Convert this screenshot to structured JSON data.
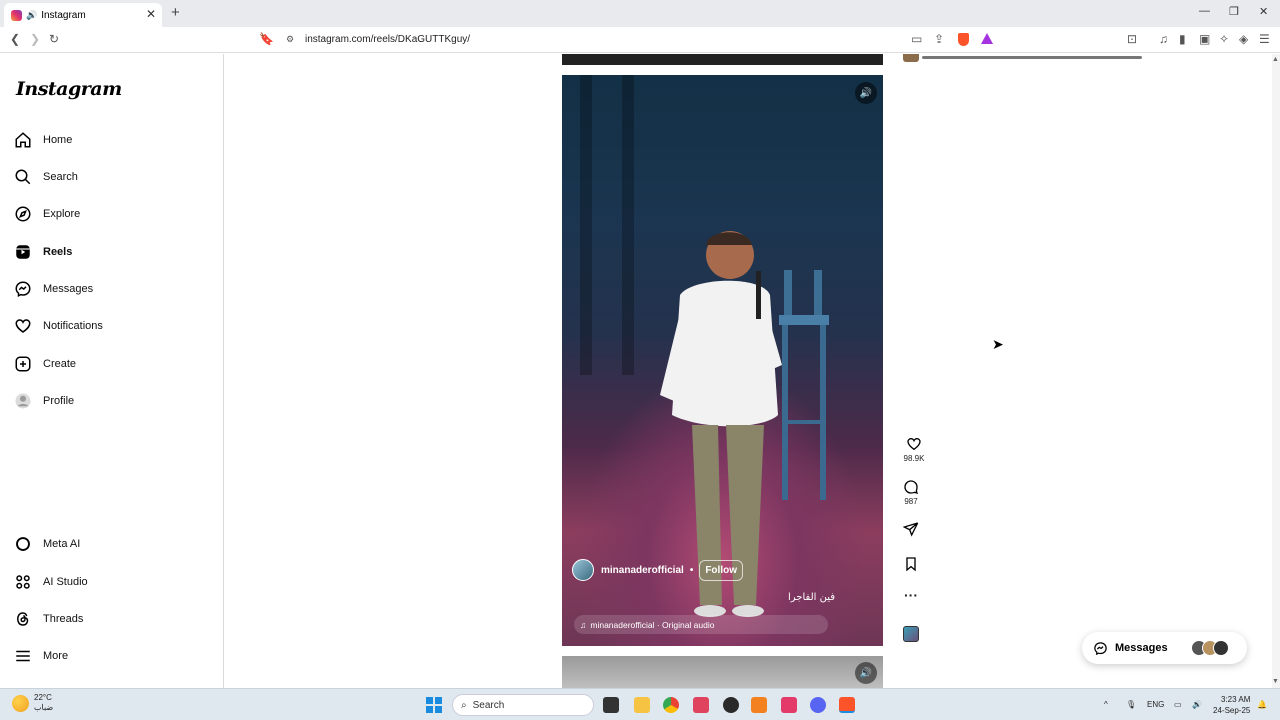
{
  "browser": {
    "tab_title": "Instagram",
    "url": "instagram.com/reels/DKaGUTTKguy/"
  },
  "sidebar": {
    "logo": "Instagram",
    "items": [
      {
        "label": "Home",
        "icon": "home-icon"
      },
      {
        "label": "Search",
        "icon": "search-icon"
      },
      {
        "label": "Explore",
        "icon": "compass-icon"
      },
      {
        "label": "Reels",
        "icon": "reels-icon",
        "active": true
      },
      {
        "label": "Messages",
        "icon": "messenger-icon"
      },
      {
        "label": "Notifications",
        "icon": "heart-icon"
      },
      {
        "label": "Create",
        "icon": "plus-square-icon"
      },
      {
        "label": "Profile",
        "icon": "avatar-icon"
      }
    ],
    "bottom_items": [
      {
        "label": "Meta AI",
        "icon": "meta-ai-ring-icon"
      },
      {
        "label": "AI Studio",
        "icon": "ai-studio-icon"
      },
      {
        "label": "Threads",
        "icon": "threads-icon"
      },
      {
        "label": "More",
        "icon": "hamburger-icon"
      }
    ]
  },
  "reel": {
    "username": "minanaderofficial",
    "follow_label": "Follow",
    "caption": "فين الفاجرا",
    "audio": "minanaderofficial · Original audio",
    "likes": "98.9K",
    "comments": "987"
  },
  "messages_pill": {
    "label": "Messages"
  },
  "taskbar": {
    "temperature": "22°C",
    "weather_desc": "ضباب",
    "search_label": "Search",
    "lang": "ENG",
    "time": "3:23 AM",
    "date": "24-Sep-25"
  },
  "colors": {
    "brave_orange": "#fb542b",
    "windows_blue": "#1a8ce0"
  }
}
